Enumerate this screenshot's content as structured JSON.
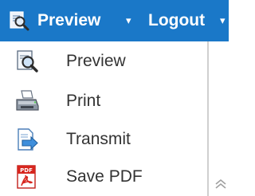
{
  "toolbar": {
    "preview_label": "Preview",
    "logout_label": "Logout",
    "background_color": "#1a78c8"
  },
  "menu": {
    "items": [
      {
        "label": "Preview",
        "icon": "magnifier-document-icon"
      },
      {
        "label": "Print",
        "icon": "printer-icon"
      },
      {
        "label": "Transmit",
        "icon": "document-arrow-icon"
      },
      {
        "label": "Save PDF",
        "icon": "pdf-icon"
      }
    ]
  },
  "colors": {
    "accent": "#1a78c8",
    "pdf_red": "#d7261e",
    "text": "#333333"
  }
}
